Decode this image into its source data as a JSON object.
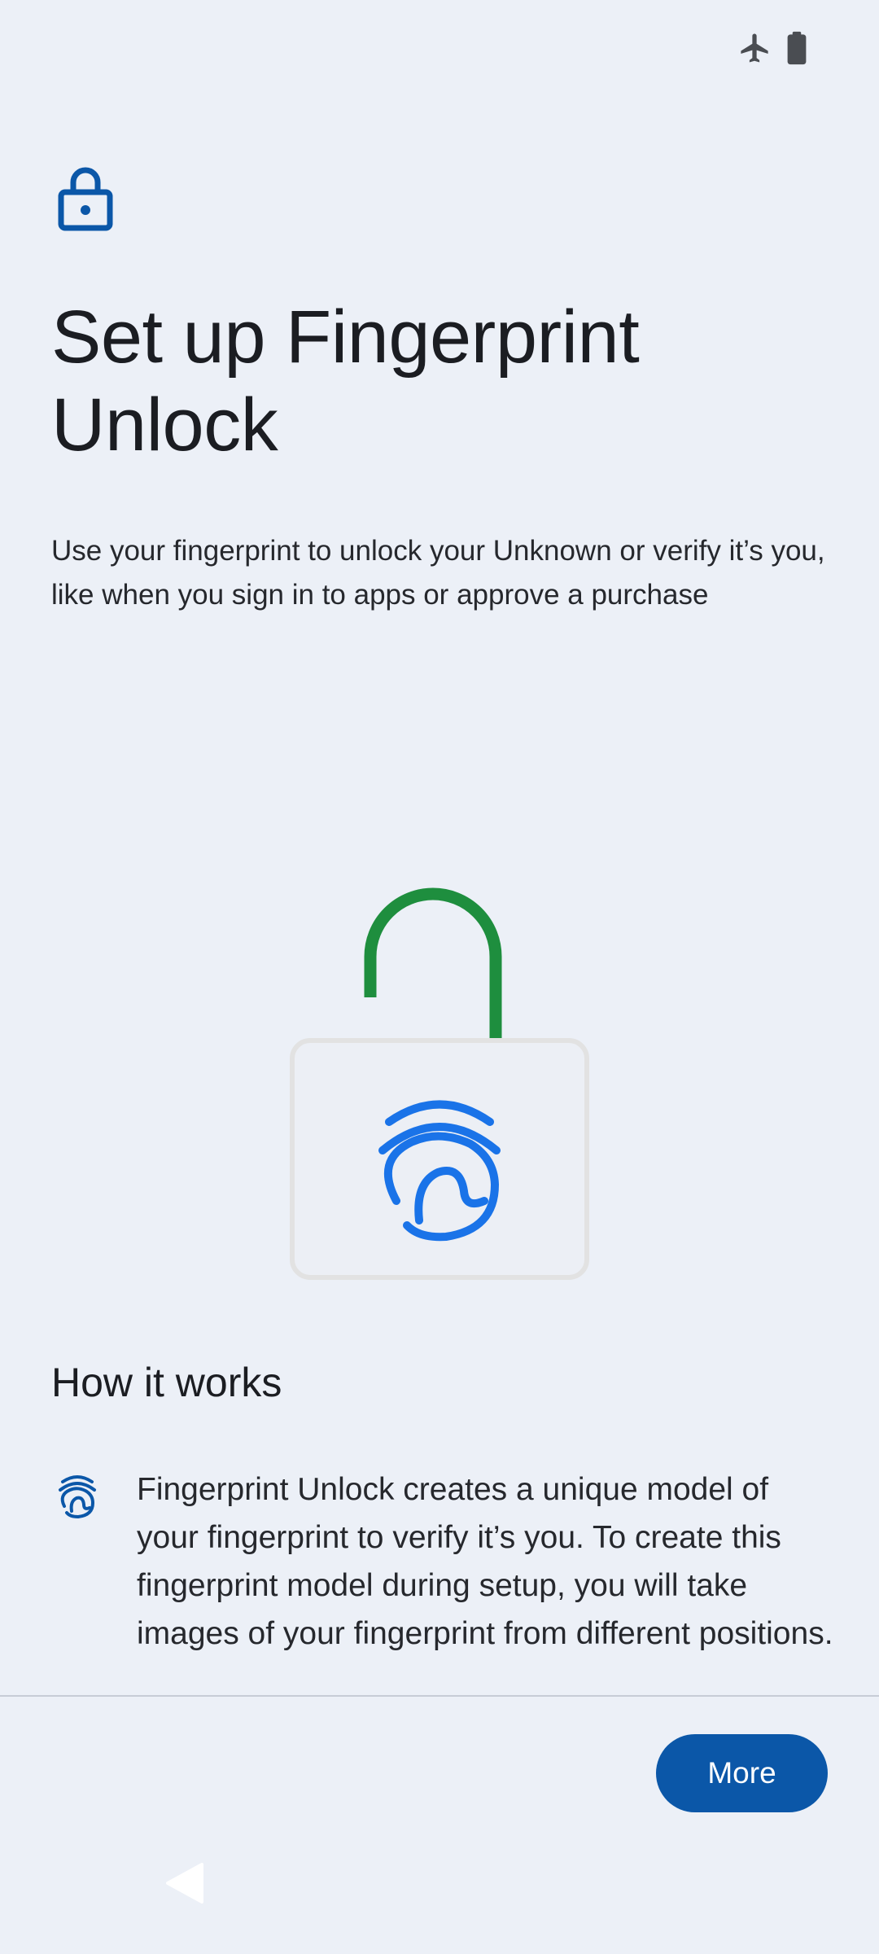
{
  "status_bar": {
    "icons": [
      "airplane-mode-icon",
      "battery-icon"
    ]
  },
  "header": {
    "icon": "lock-icon",
    "title": "Set up Fingerprint Unlock",
    "description": "Use your fingerprint to unlock your Unknown or verify it’s you, like when you sign in to apps or approve a purchase"
  },
  "illustration": {
    "icon": "unlocked-padlock-fingerprint-illustration",
    "colors": {
      "shackle": "#1e8e3e",
      "body_outline": "#e2e2e2",
      "fingerprint": "#1a73e8"
    }
  },
  "how_it_works": {
    "heading": "How it works",
    "items": [
      {
        "icon": "fingerprint-icon",
        "text": "Fingerprint Unlock creates a unique model of your fingerprint to verify it’s you. To create this fingerprint model during setup, you will take images of your fingerprint from different positions."
      }
    ]
  },
  "footer": {
    "more_label": "More",
    "accent_color": "#0b57a8"
  },
  "nav_bar": {
    "back_icon": "back-triangle-icon"
  }
}
